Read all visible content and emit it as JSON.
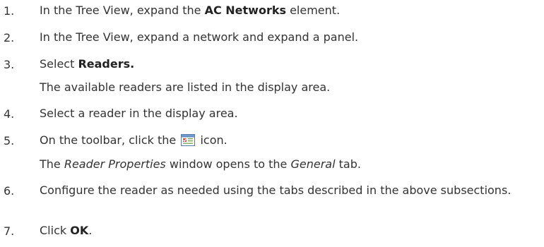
{
  "steps": [
    {
      "n": "1.",
      "pre": "In the Tree View, expand the ",
      "bold": "AC Networks",
      "post": " element."
    },
    {
      "n": "2.",
      "text": "In the Tree View, expand a network and expand a panel."
    },
    {
      "n": "3.",
      "pre": "Select ",
      "bold": "Readers.",
      "note": "The available readers are listed in the display area."
    },
    {
      "n": "4.",
      "text": "Select a reader in the display area."
    },
    {
      "n": "5.",
      "pre": "On the toolbar, click the ",
      "post": " icon.",
      "icon": "reader-properties-icon",
      "note_pre": "The ",
      "note_italic1": "Reader Properties",
      "note_mid": " window opens to the ",
      "note_italic2": "General",
      "note_post": " tab."
    },
    {
      "n": "6.",
      "text": "Configure the reader as needed using the tabs described in the above subsections."
    },
    {
      "n": "7.",
      "pre": "Click ",
      "bold": "OK",
      "post": "."
    }
  ]
}
